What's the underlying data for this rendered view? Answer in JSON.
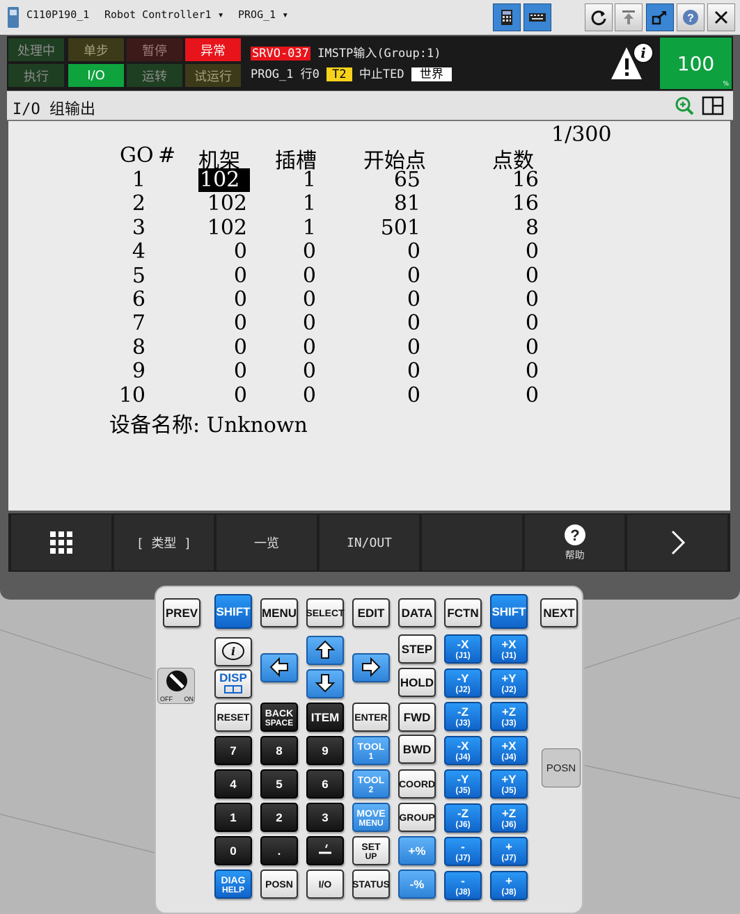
{
  "titlebar": {
    "controller": "C110P190_1",
    "robot": "Robot Controller1",
    "program": "PROG_1"
  },
  "status": {
    "leds": [
      "处理中",
      "单步",
      "暂停",
      "异常",
      "执行",
      "I/O",
      "运转",
      "试运行"
    ],
    "alarm_code": "SRVO-037",
    "alarm_text": "IMSTP输入(Group:1)",
    "line2_prog": "PROG_1",
    "line2_row": "行0",
    "line2_mode": "T2",
    "line2_state": "中止TED",
    "line2_frame": "世界",
    "override": "100",
    "override_unit": "%"
  },
  "screen": {
    "title": "I/O 组输出",
    "page": "1/300",
    "headers": {
      "go": "GO",
      "num": "#",
      "rack": "机架",
      "slot": "插槽",
      "start": "开始点",
      "points": "点数"
    },
    "rows": [
      {
        "n": "1",
        "rack": "102",
        "slot": "1",
        "start": "65",
        "points": "16"
      },
      {
        "n": "2",
        "rack": "102",
        "slot": "1",
        "start": "81",
        "points": "16"
      },
      {
        "n": "3",
        "rack": "102",
        "slot": "1",
        "start": "501",
        "points": "8"
      },
      {
        "n": "4",
        "rack": "0",
        "slot": "0",
        "start": "0",
        "points": "0"
      },
      {
        "n": "5",
        "rack": "0",
        "slot": "0",
        "start": "0",
        "points": "0"
      },
      {
        "n": "6",
        "rack": "0",
        "slot": "0",
        "start": "0",
        "points": "0"
      },
      {
        "n": "7",
        "rack": "0",
        "slot": "0",
        "start": "0",
        "points": "0"
      },
      {
        "n": "8",
        "rack": "0",
        "slot": "0",
        "start": "0",
        "points": "0"
      },
      {
        "n": "9",
        "rack": "0",
        "slot": "0",
        "start": "0",
        "points": "0"
      },
      {
        "n": "10",
        "rack": "0",
        "slot": "0",
        "start": "0",
        "points": "0"
      }
    ],
    "device_label": "设备名称:",
    "device_value": "Unknown"
  },
  "fkeys": [
    "",
    "[ 类型 ]",
    "一览",
    "IN/OUT",
    "",
    "帮助",
    ""
  ],
  "keypad": {
    "row1": [
      "PREV",
      "SHIFT",
      "MENU",
      "SELECT",
      "EDIT",
      "DATA",
      "FCTN",
      "SHIFT",
      "NEXT"
    ],
    "disp": "DISP",
    "reset": "RESET",
    "backspace_1": "BACK",
    "backspace_2": "SPACE",
    "item": "ITEM",
    "enter": "ENTER",
    "step": "STEP",
    "hold": "HOLD",
    "fwd": "FWD",
    "bwd": "BWD",
    "coord": "COORD",
    "group": "GROUP",
    "tool1_1": "TOOL",
    "tool1_2": "1",
    "tool2_1": "TOOL",
    "tool2_2": "2",
    "move_1": "MOVE",
    "move_2": "MENU",
    "setup_1": "SET",
    "setup_2": "UP",
    "pct_up": "+%",
    "pct_down": "-%",
    "digits": [
      "7",
      "8",
      "9",
      "4",
      "5",
      "6",
      "1",
      "2",
      "3",
      "0",
      "."
    ],
    "diag_1": "DIAG",
    "diag_2": "HELP",
    "posn": "POSN",
    "io": "I/O",
    "status": "STATUS",
    "jog": [
      [
        "-X",
        "(J1)",
        "+X",
        "(J1)"
      ],
      [
        "-Y",
        "(J2)",
        "+Y",
        "(J2)"
      ],
      [
        "-Z",
        "(J3)",
        "+Z",
        "(J3)"
      ],
      [
        "-X",
        "(J4)",
        "+X",
        "(J4)"
      ],
      [
        "-Y",
        "(J5)",
        "+Y",
        "(J5)"
      ],
      [
        "-Z",
        "(J6)",
        "+Z",
        "(J6)"
      ],
      [
        "-",
        "(J7)",
        "+",
        "(J7)"
      ],
      [
        "-",
        "(J8)",
        "+",
        "(J8)"
      ]
    ],
    "side_posn": "POSN",
    "off_label": "OFF",
    "on_label": "ON"
  }
}
